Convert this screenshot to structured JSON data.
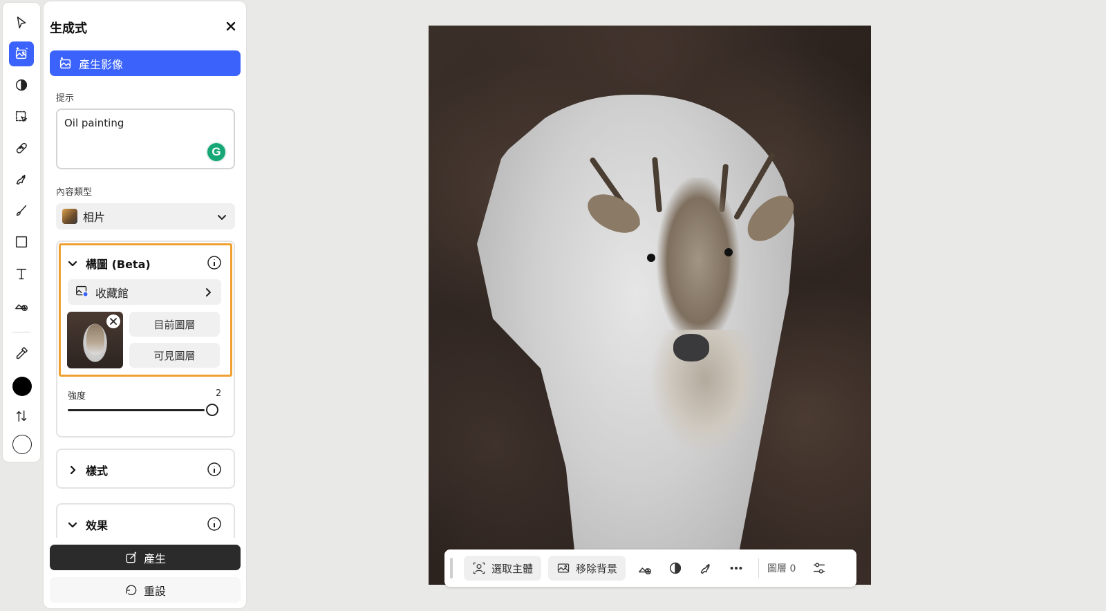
{
  "panel": {
    "title": "生成式",
    "generate_image_label": "產生影像",
    "prompt_label": "提示",
    "prompt_value": "Oil painting",
    "content_type_label": "內容類型",
    "content_type_value": "相片",
    "composition": {
      "title": "構圖 (Beta)",
      "gallery_label": "收藏館",
      "current_layer_label": "目前圖層",
      "visible_layer_label": "可見圖層",
      "strength_label": "強度",
      "strength_value": "2"
    },
    "style_section_label": "樣式",
    "effects_section_label": "效果",
    "generate_button_label": "產生",
    "reset_button_label": "重設"
  },
  "actionbar": {
    "select_subject_label": "選取主體",
    "remove_background_label": "移除背景",
    "layers_label": "圖層 0"
  },
  "colors": {
    "accent": "#3b63fb",
    "highlight": "#f0a030",
    "generate_button": "#2b2b2b"
  }
}
